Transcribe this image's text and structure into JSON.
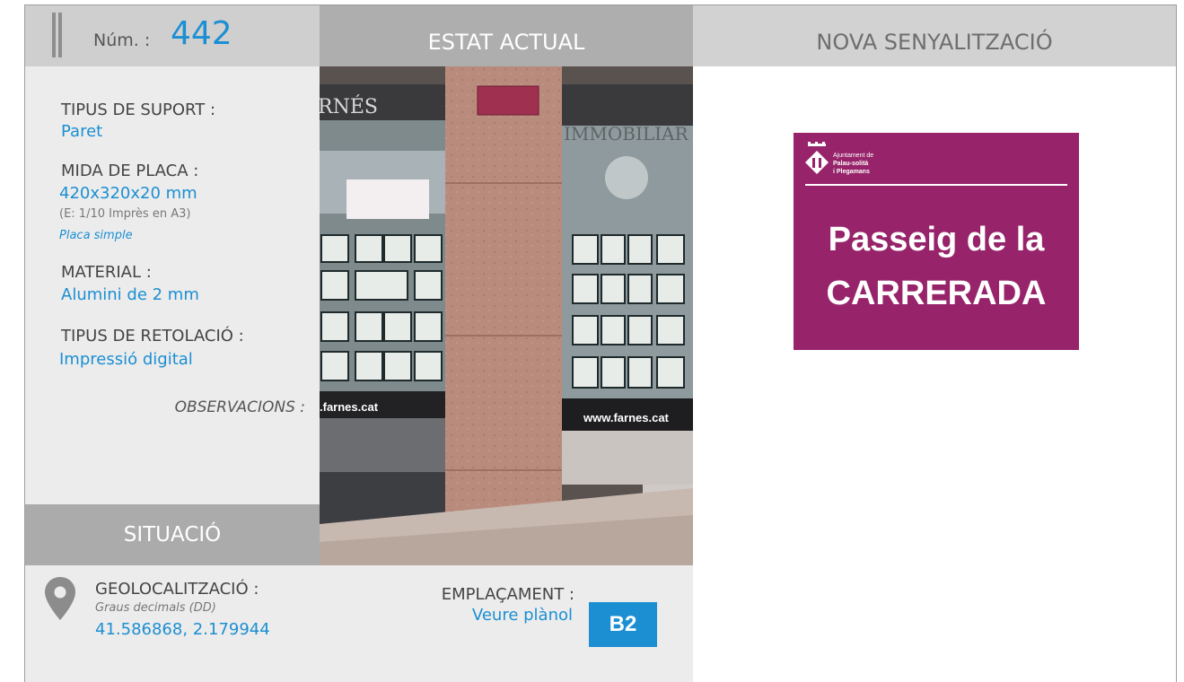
{
  "header": {
    "num_label": "Núm. :",
    "num_value": "442",
    "current_state_title": "ESTAT ACTUAL",
    "new_signage_title": "NOVA SENYALITZACIÓ"
  },
  "info": {
    "support_type_label": "TIPUS DE SUPORT :",
    "support_type_value": "Paret",
    "plate_size_label": "MIDA DE PLACA :",
    "plate_size_value": "420x320x20 mm",
    "plate_size_note": "(E: 1/10 Imprès en A3)",
    "plate_kind": "Placa simple",
    "material_label": "MATERIAL :",
    "material_value": "Alumini de 2 mm",
    "lettering_label": "TIPUS DE RETOLACIÓ :",
    "lettering_value": "Impressió digital",
    "observations_label": "OBSERVACIONS :"
  },
  "situation": {
    "title": "SITUACIÓ",
    "geo_label": "GEOLOCALITZACIÓ :",
    "geo_format": "Graus decimals (DD)",
    "geo_value": "41.586868, 2.179944",
    "location_label": "EMPLAÇAMENT :",
    "location_link": "Veure plànol",
    "location_code": "B2"
  },
  "photo": {
    "shop_sign_left": "RNÉS",
    "shop_sign_right": "IMMOBILIAR",
    "web_left": ".farnes.cat",
    "web_right": "www.farnes.cat"
  },
  "sign": {
    "org_line1": "Ajuntament de",
    "org_line2": "Palau-solità",
    "org_line3": "i Plegamans",
    "street_line1": "Passeig de la",
    "street_line2": "CARRERADA",
    "background_color": "#97246a"
  },
  "icons": {
    "location": "map-pin-icon"
  }
}
